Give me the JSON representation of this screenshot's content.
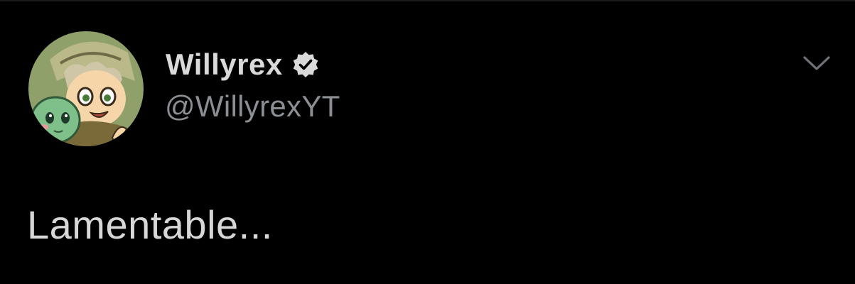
{
  "tweet": {
    "author": {
      "display_name": "Willyrex",
      "handle": "@WillyrexYT",
      "verified": true,
      "avatar_icon": "cartoon-avatar-icon"
    },
    "text": "Lamentable...",
    "menu_icon": "chevron-down-icon"
  },
  "colors": {
    "background": "#000000",
    "name": "#d9d9d9",
    "handle": "#8b8f94",
    "text": "#d7d7d7",
    "badge": "#d9d9d9"
  }
}
